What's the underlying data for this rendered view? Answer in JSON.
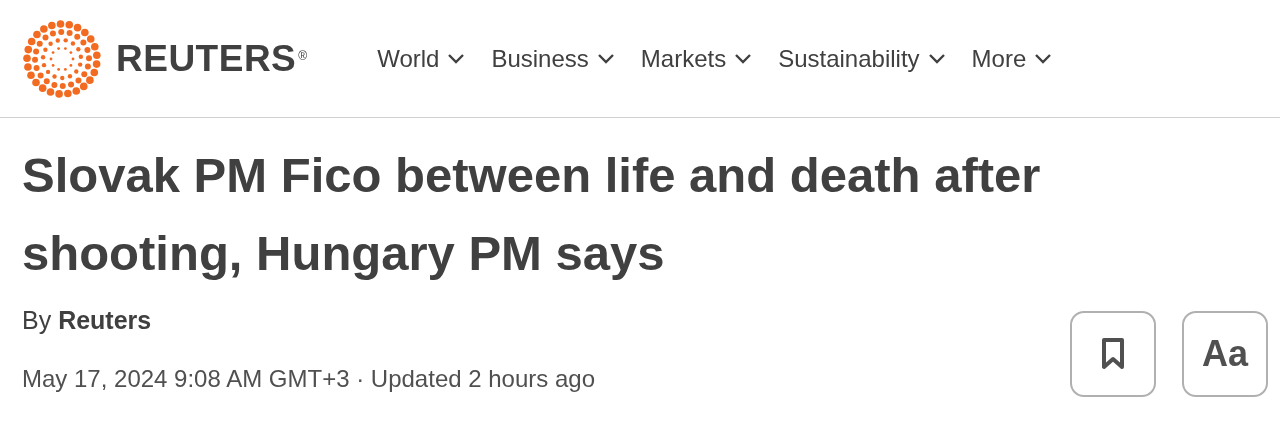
{
  "logo": {
    "wordmark": "REUTERS",
    "registered": "®"
  },
  "nav": [
    {
      "label": "World",
      "expanded": false
    },
    {
      "label": "Business",
      "expanded": false
    },
    {
      "label": "Markets",
      "expanded": false
    },
    {
      "label": "Sustainability",
      "expanded": false
    },
    {
      "label": "More",
      "expanded": false
    }
  ],
  "article": {
    "headline": "Slovak PM Fico between life and death after shooting, Hungary PM says",
    "byline": "By **Reuters**",
    "dateline": "May 17, 2024 9:08 AM GMT+3 · Updated 2 hours ago",
    "font_button": "Aa"
  }
}
